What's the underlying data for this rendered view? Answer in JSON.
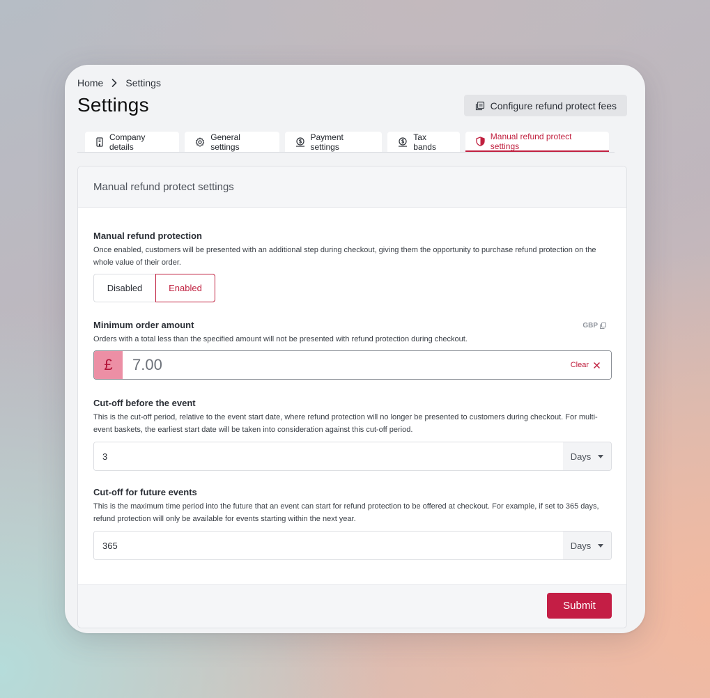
{
  "breadcrumb": {
    "home": "Home",
    "current": "Settings"
  },
  "page": {
    "title": "Settings"
  },
  "header": {
    "config_label": "Configure refund protect fees"
  },
  "tabs": [
    {
      "label": "Company details",
      "icon": "building-icon"
    },
    {
      "label": "General settings",
      "icon": "gear-icon"
    },
    {
      "label": "Payment settings",
      "icon": "payment-icon"
    },
    {
      "label": "Tax bands",
      "icon": "tax-icon"
    },
    {
      "label": "Manual refund protect settings",
      "icon": "shield-icon",
      "active": true
    }
  ],
  "card": {
    "title": "Manual refund protect settings",
    "protection": {
      "label": "Manual refund protection",
      "description": "Once enabled, customers will be presented with an additional step during checkout, giving them the opportunity to purchase refund protection on the whole value of their order.",
      "disabled_label": "Disabled",
      "enabled_label": "Enabled",
      "selected": "Enabled"
    },
    "min_order": {
      "label": "Minimum order amount",
      "currency_code": "GBP",
      "description": "Orders with a total less than the specified amount will not be presented with refund protection during checkout.",
      "currency_symbol": "£",
      "value": "7.00",
      "clear_label": "Clear"
    },
    "cutoff_before": {
      "label": "Cut-off before the event",
      "description": "This is the cut-off period, relative to the event start date, where refund protection will no longer be presented to customers during checkout. For multi-event baskets, the earliest start date will be taken into consideration against this cut-off period.",
      "value": "3",
      "unit": "Days"
    },
    "cutoff_future": {
      "label": "Cut-off for future events",
      "description": "This is the maximum time period into the future that an event can start for refund protection to be offered at checkout. For example, if set to 365 days, refund protection will only be available for events starting within the next year.",
      "value": "365",
      "unit": "Days"
    },
    "submit_label": "Submit"
  },
  "colors": {
    "accent": "#c0203f",
    "accent_light": "#ec8fa5",
    "submit": "#c41e45"
  }
}
